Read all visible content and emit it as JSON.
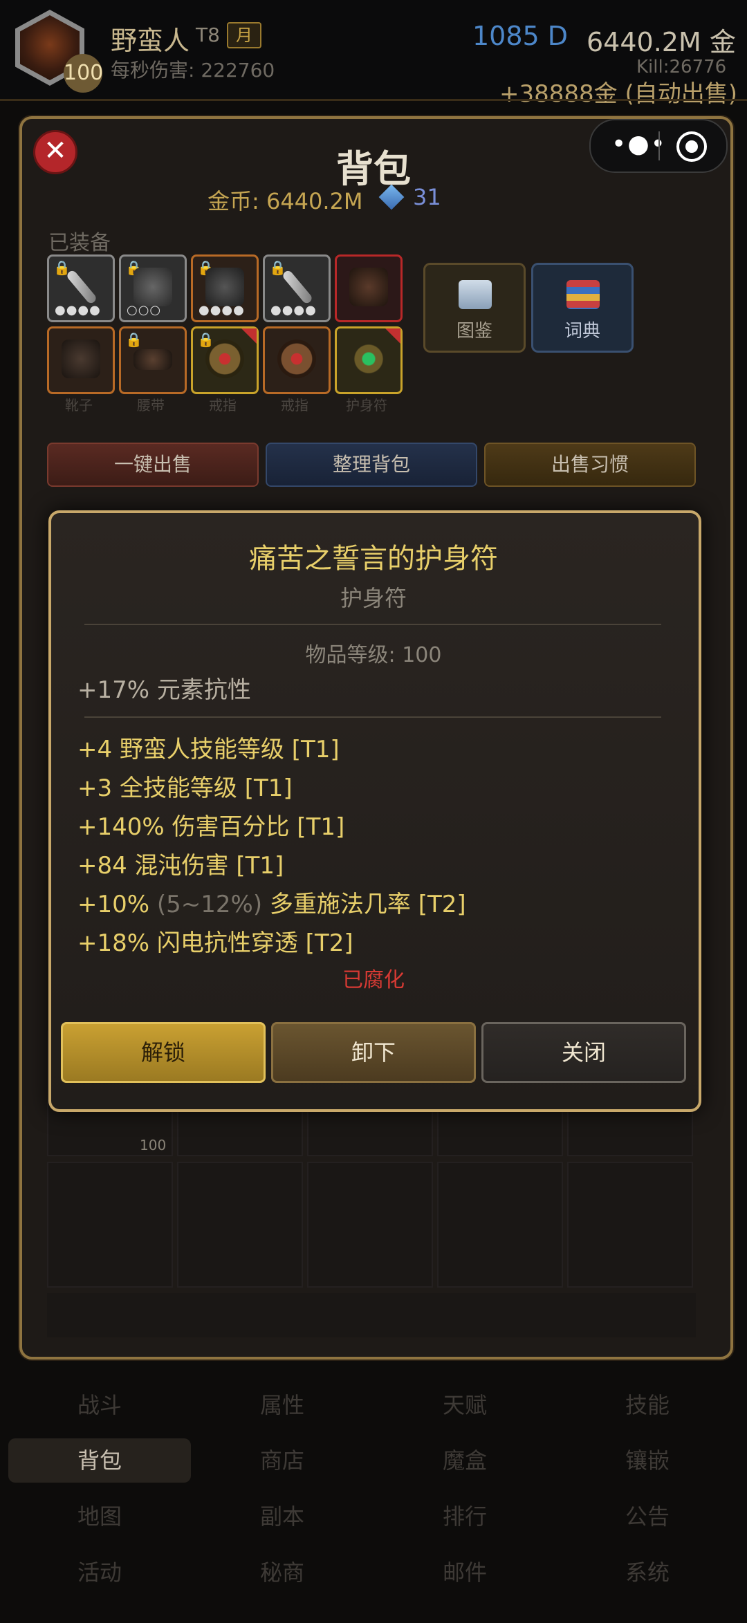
{
  "header": {
    "hero_name": "野蛮人",
    "tier": "T8",
    "month_badge": "月",
    "level": "100",
    "dps_text": "每秒伤害: 222760",
    "diamonds": "1085 D",
    "gold": "6440.2M 金",
    "kill": "Kill:26776",
    "autosell": "+38888金 (自动出售)"
  },
  "panel": {
    "title": "背包",
    "coins": "金币: 6440.2M",
    "gems": "31",
    "equipped_label": "已装备",
    "slot_labels": [
      "靴子",
      "腰带",
      "戒指",
      "戒指",
      "护身符"
    ],
    "side_buttons": [
      {
        "label": "图鉴",
        "icon": "book-icon"
      },
      {
        "label": "词典",
        "icon": "books-stack-icon"
      }
    ],
    "actions": [
      "一键出售",
      "整理背包",
      "出售习惯"
    ],
    "bag_item_level": "100"
  },
  "tooltip": {
    "item_name": "痛苦之誓言的护身符",
    "item_type": "护身符",
    "item_level": "物品等级: 100",
    "implicit": "+17% 元素抗性",
    "affixes": [
      {
        "text": "+4 野蛮人技能等级 [T1]"
      },
      {
        "text": "+3 全技能等级 [T1]"
      },
      {
        "text": "+140% 伤害百分比 [T1]"
      },
      {
        "text": "+84 混沌伤害 [T1]"
      },
      {
        "pre": "+10% ",
        "range": "(5~12%)",
        "post": " 多重施法几率 [T2]"
      },
      {
        "text": "+18% 闪电抗性穿透 [T2]"
      }
    ],
    "corrupted": "已腐化",
    "buttons": {
      "unlock": "解锁",
      "unequip": "卸下",
      "close": "关闭"
    }
  },
  "nav": {
    "rows": [
      [
        "战斗",
        "属性",
        "天赋",
        "技能"
      ],
      [
        "背包",
        "商店",
        "魔盒",
        "镶嵌"
      ],
      [
        "地图",
        "副本",
        "排行",
        "公告"
      ],
      [
        "活动",
        "秘商",
        "邮件",
        "系统"
      ]
    ],
    "active": "背包"
  },
  "colors": {
    "accent_gold": "#e8cf6a",
    "corrupted_red": "#d83a34",
    "panel_border": "#c8a86a"
  }
}
